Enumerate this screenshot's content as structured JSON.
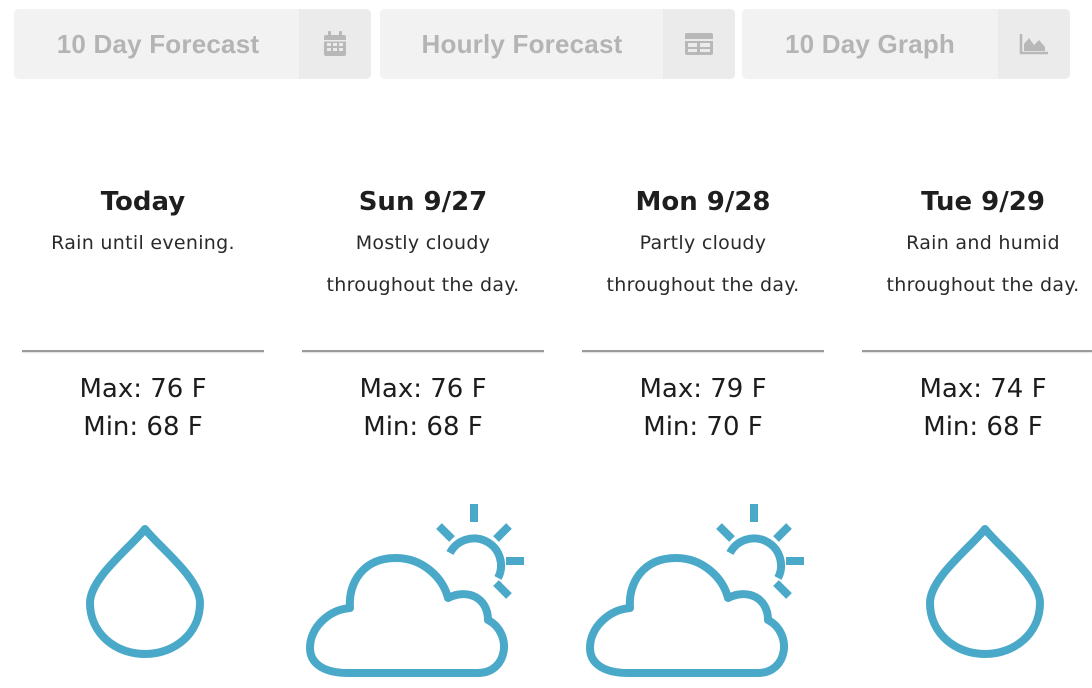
{
  "tabs": [
    {
      "label": "10 Day Forecast",
      "icon": "calendar-icon"
    },
    {
      "label": "Hourly Forecast",
      "icon": "table-icon"
    },
    {
      "label": "10 Day Graph",
      "icon": "area-chart-icon"
    }
  ],
  "days": [
    {
      "title": "Today",
      "description_line1": "Rain until evening.",
      "description_line2": "",
      "max": "Max: 76 F",
      "min": "Min: 68 F",
      "icon": "raindrop-icon"
    },
    {
      "title": "Sun 9/27",
      "description_line1": "Mostly cloudy",
      "description_line2": "throughout the day.",
      "max": "Max: 76 F",
      "min": "Min: 68 F",
      "icon": "partly-cloudy-icon"
    },
    {
      "title": "Mon 9/28",
      "description_line1": "Partly cloudy",
      "description_line2": "throughout the day.",
      "max": "Max: 79 F",
      "min": "Min: 70 F",
      "icon": "partly-cloudy-icon"
    },
    {
      "title": "Tue 9/29",
      "description_line1": "Rain and humid",
      "description_line2": "throughout the day.",
      "max": "Max: 74 F",
      "min": "Min: 68 F",
      "icon": "raindrop-icon"
    }
  ],
  "colors": {
    "icon_stroke": "#4aa9c8",
    "tab_bg": "#f2f2f2",
    "tab_text": "#b4b4b4"
  }
}
